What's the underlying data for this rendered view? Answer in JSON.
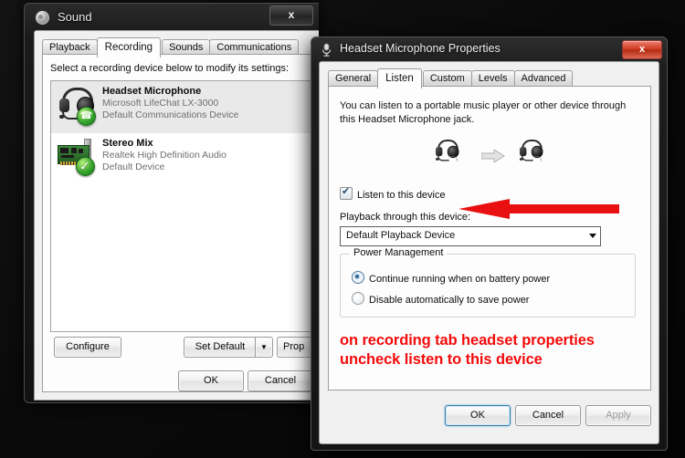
{
  "sound_window": {
    "title": "Sound",
    "icon": "speaker-icon",
    "close_label": "x",
    "tabs": [
      {
        "label": "Playback",
        "active": false
      },
      {
        "label": "Recording",
        "active": true
      },
      {
        "label": "Sounds",
        "active": false
      },
      {
        "label": "Communications",
        "active": false
      }
    ],
    "instruction": "Select a recording device below to modify its settings:",
    "devices": [
      {
        "name": "Headset Microphone",
        "driver": "Microsoft LifeChat LX-3000",
        "status": "Default Communications Device",
        "icon": "headset-icon",
        "badge": "phone-badge",
        "selected": true
      },
      {
        "name": "Stereo Mix",
        "driver": "Realtek High Definition Audio",
        "status": "Default Device",
        "icon": "sound-card-icon",
        "badge": "check-badge",
        "selected": false
      }
    ],
    "buttons": {
      "configure": "Configure",
      "set_default": "Set Default",
      "set_default_arrow": "▼",
      "properties": "Prop",
      "ok": "OK",
      "cancel": "Cancel",
      "apply": ""
    }
  },
  "properties_window": {
    "title": "Headset Microphone Properties",
    "icon": "microphone-icon",
    "close_label": "x",
    "tabs": [
      {
        "label": "General",
        "active": false
      },
      {
        "label": "Listen",
        "active": true
      },
      {
        "label": "Custom",
        "active": false
      },
      {
        "label": "Levels",
        "active": false
      },
      {
        "label": "Advanced",
        "active": false
      }
    ],
    "description": "You can listen to a portable music player or other device through this Headset Microphone jack.",
    "illustration": {
      "left_icon": "headset-icon",
      "arrow_icon": "arrow-right-icon",
      "right_icon": "headset-icon"
    },
    "listen_checkbox": {
      "label": "Listen to this device",
      "checked": true
    },
    "playback_label": "Playback through this device:",
    "playback_value": "Default Playback Device",
    "playback_arrow": "chevron-down-icon",
    "power_management": {
      "legend": "Power Management",
      "options": [
        {
          "label": "Continue running when on battery power",
          "selected": true
        },
        {
          "label": "Disable automatically to save power",
          "selected": false
        }
      ]
    },
    "buttons": {
      "ok": "OK",
      "cancel": "Cancel",
      "apply": "Apply",
      "apply_disabled": true,
      "ok_focused": true
    }
  },
  "annotation": {
    "line1": "on recording tab headset properties",
    "line2": "uncheck listen to this device",
    "color": "#f40b0b",
    "arrow": "red-left-arrow"
  },
  "desktop": {
    "background_color": "#0a0a0a"
  }
}
